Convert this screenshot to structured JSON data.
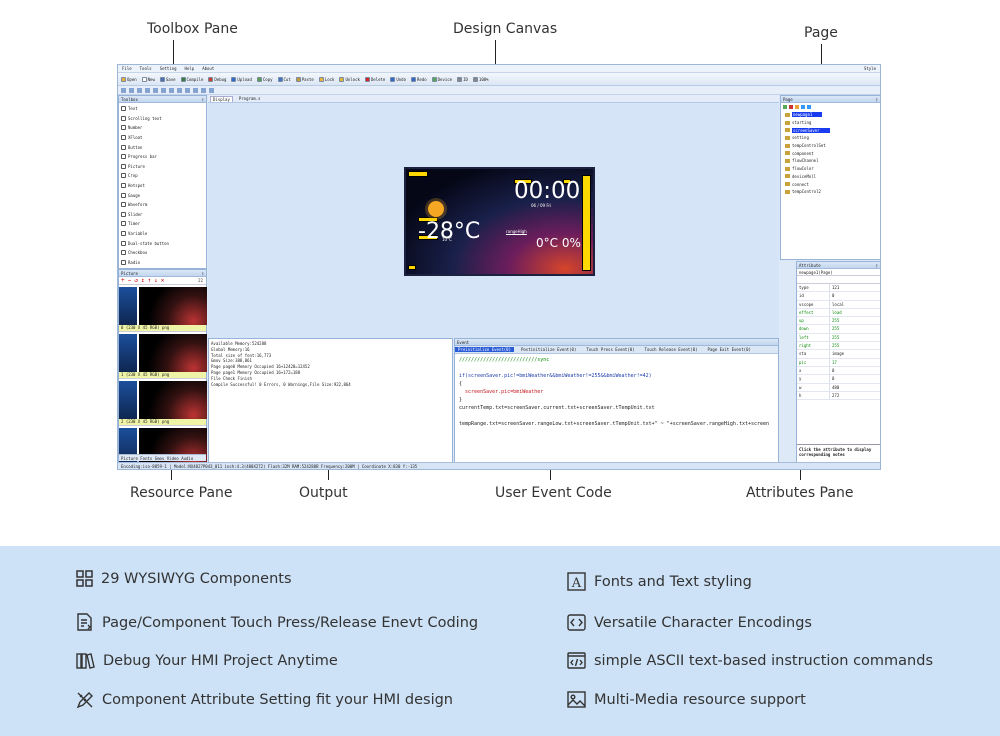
{
  "callouts": {
    "toolbox": "Toolbox Pane",
    "canvas": "Design Canvas",
    "page": "Page",
    "resource": "Resource Pane",
    "output": "Output",
    "event": "User Event Code",
    "attributes": "Attributes Pane"
  },
  "ide": {
    "menu": [
      "File",
      "Tools",
      "Setting",
      "Help",
      "About"
    ],
    "style_label": "Style",
    "toolbar": [
      {
        "label": "Open",
        "icon": "open-icon",
        "color": "#e8b13a"
      },
      {
        "label": "New",
        "icon": "new-icon",
        "color": "#ffffff"
      },
      {
        "label": "Save",
        "icon": "save-icon",
        "color": "#4b6fb5"
      },
      {
        "label": "Compile",
        "icon": "compile-icon",
        "color": "#3a7d3a"
      },
      {
        "label": "Debug",
        "icon": "debug-icon",
        "color": "#cf3e2b"
      },
      {
        "label": "Upload",
        "icon": "upload-icon",
        "color": "#2f6bc9"
      },
      {
        "label": "Copy",
        "icon": "copy-icon",
        "color": "#5aa04a"
      },
      {
        "label": "Cut",
        "icon": "cut-icon",
        "color": "#4472c4"
      },
      {
        "label": "Paste",
        "icon": "paste-icon",
        "color": "#c9963a"
      },
      {
        "label": "Lock",
        "icon": "lock-icon",
        "color": "#e6b53a"
      },
      {
        "label": "Unlock",
        "icon": "unlock-icon",
        "color": "#e6b53a"
      },
      {
        "label": "Delete",
        "icon": "delete-icon",
        "color": "#d22"
      },
      {
        "label": "Undo",
        "icon": "undo-icon",
        "color": "#2f6bc9"
      },
      {
        "label": "Redo",
        "icon": "redo-icon",
        "color": "#2f6bc9"
      },
      {
        "label": "Device",
        "icon": "device-icon",
        "color": "#5a5"
      },
      {
        "label": "ID",
        "icon": "id-icon",
        "color": "#888"
      },
      {
        "label": "100%",
        "icon": "zoom-icon",
        "color": "#888"
      }
    ],
    "toolbox": {
      "title": "Toolbox",
      "items": [
        "Text",
        "Scrolling text",
        "Number",
        "XFloat",
        "Button",
        "Progress bar",
        "Picture",
        "Crop",
        "Hotspot",
        "Gauge",
        "Waveform",
        "Slider",
        "Timer",
        "Variable",
        "Dual-state button",
        "Checkbox",
        "Radio"
      ]
    },
    "picture": {
      "title": "Picture",
      "items": [
        "0 (230 X 45 RGB) png",
        "1 (230 X 45 RGB) png",
        "2 (230 X 45 RGB) png",
        "3 (230 X 45 RGB) png"
      ],
      "count": "22",
      "tabs": "Picture  Fonts  Gmov  Video  Audio"
    },
    "canvas_tabs": [
      "Display",
      "Program.s"
    ],
    "hmi": {
      "time": "00:00",
      "temp": "-28°C",
      "small_temp": "10°C",
      "date": "06 / 09 Fri",
      "readings": "0°C  0%",
      "label": "rangeHigh"
    },
    "page_pane": {
      "title": "Page",
      "items": [
        "newpage1",
        "starting",
        "screenSaver",
        "setting",
        "tempControlSet",
        "component",
        "flowChannel",
        "flowColor",
        "deviceMoll",
        "connect",
        "tempControl2"
      ],
      "selected": [
        0,
        2
      ]
    },
    "attributes": {
      "title": "Attribute",
      "header": "newpage1(Page)",
      "rows": [
        {
          "k": "type",
          "v": "121",
          "green": false
        },
        {
          "k": "id",
          "v": "0",
          "green": false
        },
        {
          "k": "vscope",
          "v": "local",
          "green": false
        },
        {
          "k": "effect",
          "v": "load",
          "green": true
        },
        {
          "k": "up",
          "v": "255",
          "green": true
        },
        {
          "k": "down",
          "v": "255",
          "green": true
        },
        {
          "k": "left",
          "v": "255",
          "green": true
        },
        {
          "k": "right",
          "v": "255",
          "green": true
        },
        {
          "k": "sta",
          "v": "image",
          "green": false
        },
        {
          "k": "pic",
          "v": "17",
          "green": true
        },
        {
          "k": "x",
          "v": "0",
          "green": false
        },
        {
          "k": "y",
          "v": "0",
          "green": false
        },
        {
          "k": "w",
          "v": "480",
          "green": false
        },
        {
          "k": "h",
          "v": "272",
          "green": false
        }
      ],
      "hint": "Click the attribute to display corresponding notes"
    },
    "output": {
      "title": "Output",
      "text": "Available Memory:524288\nGlobal Memory:16\nTotal size of font:16,773\nGmov Size:388,861\nPage page0 Memory Occupied 16+12420=12452\nPage page1 Memory Occupied 16+172=188\nFile Check Finish\nCompile Successful! 0 Errors, 0 Warnings,File Size:922,864"
    },
    "event": {
      "title": "Event",
      "tabs": [
        "Preinitialize Event(0)",
        "Postinitialize Event(0)",
        "Touch Press Event(0)",
        "Touch Release Event(0)",
        "Page Exit Event(0)"
      ],
      "lines": [
        {
          "text": "//////////////////////////sync",
          "cls": "green"
        },
        {
          "text": "",
          "cls": ""
        },
        {
          "text": "if(screenSaver.pic!=bmiWeather&&bmiWeather!=255&&bmiWeather!=42)",
          "cls": "blue"
        },
        {
          "text": "{",
          "cls": ""
        },
        {
          "text": "  screenSaver.pic=bmiWeather",
          "cls": "red"
        },
        {
          "text": "}",
          "cls": ""
        },
        {
          "text": "currentTemp.txt=screenSaver.current.txt+screenSaver.tTempUnit.txt",
          "cls": ""
        },
        {
          "text": "",
          "cls": ""
        },
        {
          "text": "tempRange.txt=screenSaver.rangeLow.txt+screenSaver.tTempUnit.txt+\" ~ \"+screenSaver.rangeHigh.txt+screen",
          "cls": ""
        }
      ]
    },
    "status": "Encoding:iso-8859-1  |  Model:NX4827P043_011  inch:4.3(480X272)  Flash:32M  RAM:524288B  Frequency:200M  |  Coordinate X:830  Y:-135"
  },
  "features": [
    {
      "icon": "grid-icon",
      "text": "29 WYSIWYG Components"
    },
    {
      "icon": "font-icon",
      "text": "Fonts and Text styling"
    },
    {
      "icon": "code-file-icon",
      "text": "Page/Component Touch Press/Release Enevt Coding"
    },
    {
      "icon": "code-tag-icon",
      "text": "Versatile Character Encodings"
    },
    {
      "icon": "books-icon",
      "text": "Debug Your HMI Project Anytime"
    },
    {
      "icon": "terminal-icon",
      "text": "simple ASCII text-based instruction commands"
    },
    {
      "icon": "pencil-ruler-icon",
      "text": "Component Attribute Setting fit your HMI design"
    },
    {
      "icon": "image-icon",
      "text": "Multi-Media resource support"
    }
  ]
}
